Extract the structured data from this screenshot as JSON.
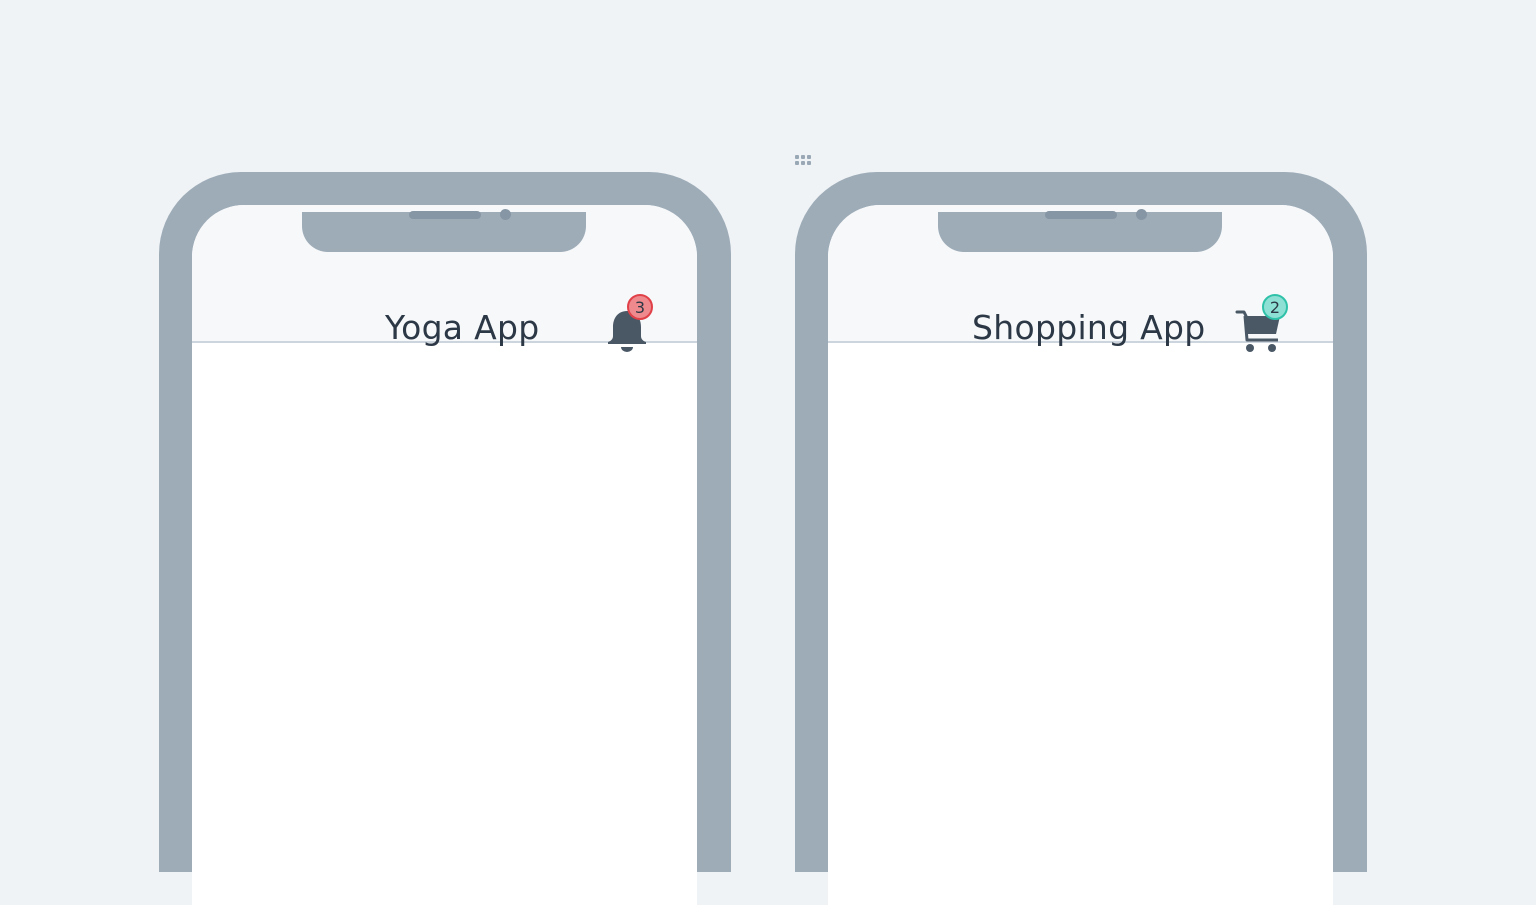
{
  "phones": [
    {
      "app_title": "Yoga App",
      "icon": "bell-icon",
      "badge_count": "3",
      "badge_color": "#ee8a8e",
      "badge_border": "#e04048"
    },
    {
      "app_title": "Shopping App",
      "icon": "shopping-cart-icon",
      "badge_count": "2",
      "badge_color": "#8ee0d4",
      "badge_border": "#2fc2a9"
    }
  ],
  "colors": {
    "background": "#eff3f6",
    "phone_frame": "#9eacb8",
    "header_bg": "#f6f8fa",
    "icon": "#4a5866",
    "title_text": "#2c3845"
  }
}
